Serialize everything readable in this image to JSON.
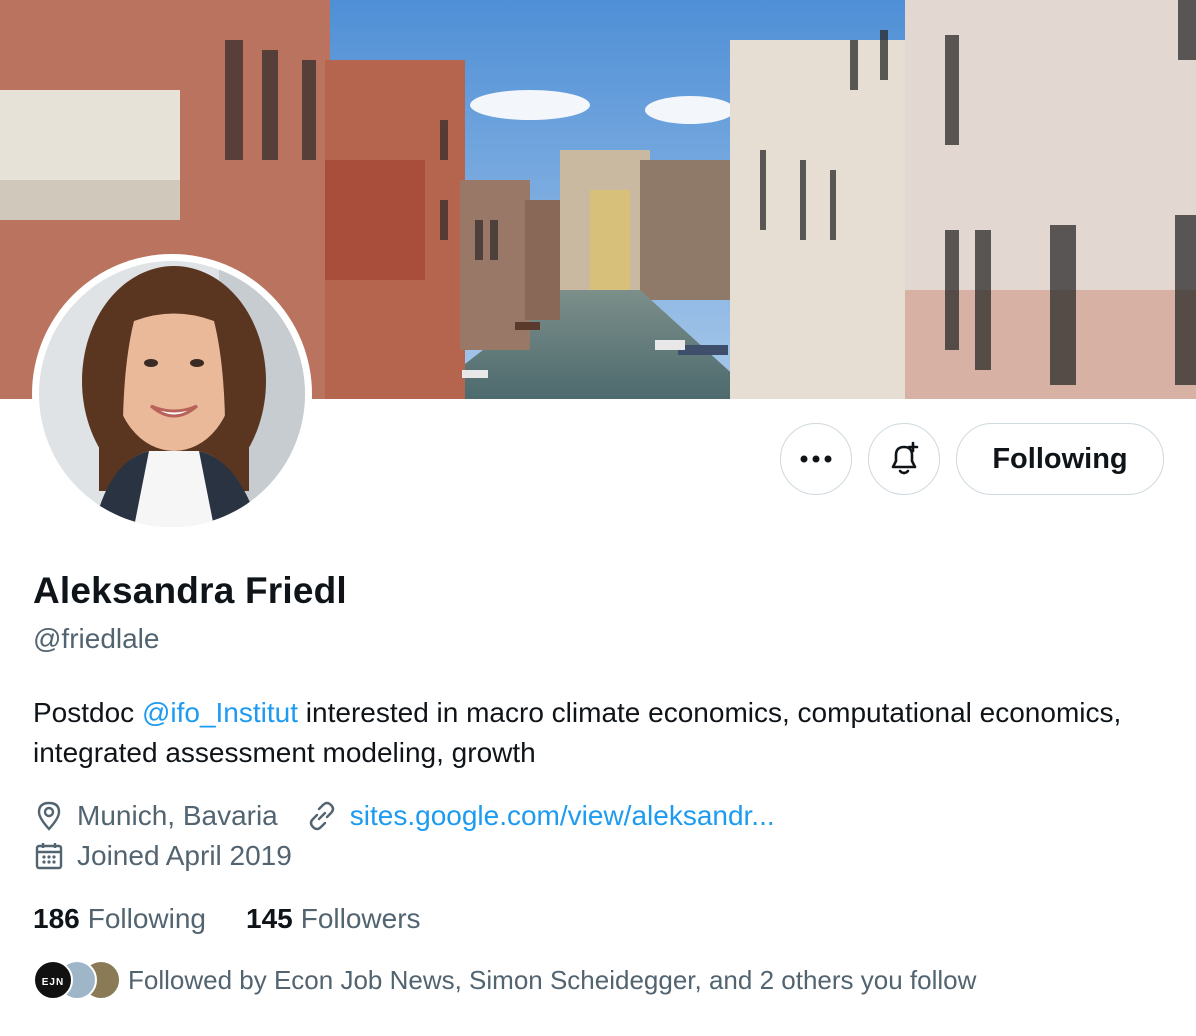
{
  "profile": {
    "name": "Aleksandra Friedl",
    "handle": "@friedlale",
    "bio_prefix": "Postdoc ",
    "bio_mention": "@ifo_Institut",
    "bio_suffix": " interested in macro climate economics, computational economics, integrated assessment modeling, growth",
    "location": "Munich, Bavaria",
    "website": "sites.google.com/view/aleksandr...",
    "joined": "Joined April 2019"
  },
  "actions": {
    "more_label": "•••",
    "following_label": "Following"
  },
  "stats": {
    "following_count": "186",
    "following_label": "Following",
    "followers_count": "145",
    "followers_label": "Followers"
  },
  "followed_by": {
    "text": "Followed by Econ Job News, Simon Scheidegger, and 2 others you follow",
    "first_avatar_text": "EJN"
  },
  "icons": {
    "more": "more-icon",
    "notify": "bell-plus-icon",
    "location": "location-pin-icon",
    "link": "link-icon",
    "calendar": "calendar-icon"
  },
  "colors": {
    "accent": "#1d9bf0",
    "secondary_text": "#536471",
    "primary_text": "#0f1419",
    "border": "#cfd9de"
  }
}
